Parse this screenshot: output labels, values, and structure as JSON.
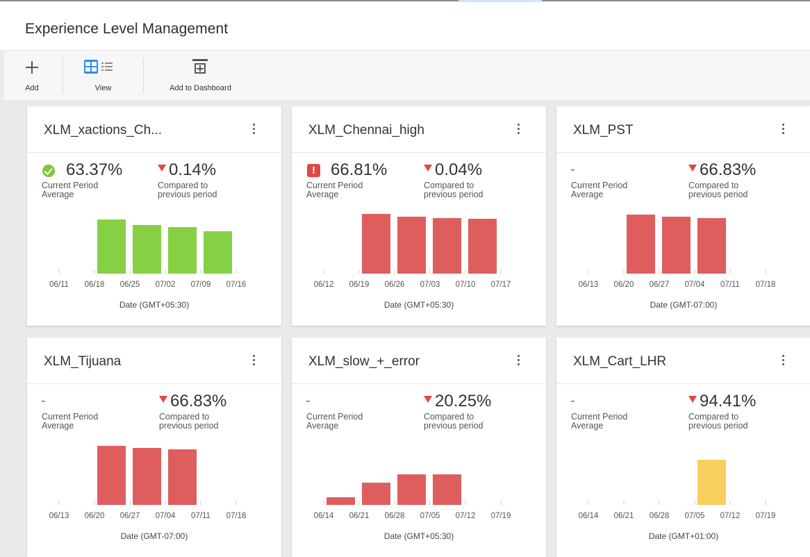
{
  "header": {
    "title": "Experience Level Management"
  },
  "toolbar": {
    "add_label": "Add",
    "view_label": "View",
    "dashboard_label": "Add to Dashboard"
  },
  "colors": {
    "good": "#86d043",
    "bad": "#de5e5e",
    "warn": "#f7cf5c",
    "accent": "#2f8ee8"
  },
  "cards": [
    {
      "name": "XLM_xactions_Ch...",
      "status_icon": "check-circle-icon",
      "current_value": "63.37%",
      "current_label": "Current Period Average",
      "compare_value": "0.14%",
      "compare_label": "Compared to previous period",
      "chart_data": {
        "type": "bar",
        "color": "#86d043",
        "categories": [
          "06/11",
          "06/18",
          "06/25",
          "07/02",
          "07/09",
          "07/16"
        ],
        "values": [
          null,
          0.65,
          0.58,
          0.56,
          0.51,
          null
        ],
        "ylim": [
          0,
          1
        ],
        "xlabel": "Date (GMT+05:30)"
      }
    },
    {
      "name": "XLM_Chennai_high",
      "status_icon": "alert-square-icon",
      "current_value": "66.81%",
      "current_label": "Current Period Average",
      "compare_value": "0.04%",
      "compare_label": "Compared to previous period",
      "chart_data": {
        "type": "bar",
        "color": "#de5e5e",
        "categories": [
          "06/12",
          "06/19",
          "06/26",
          "07/03",
          "07/10",
          "07/17"
        ],
        "values": [
          null,
          0.72,
          0.68,
          0.67,
          0.66,
          null
        ],
        "ylim": [
          0,
          1
        ],
        "xlabel": "Date (GMT+05:30)"
      }
    },
    {
      "name": "XLM_PST",
      "status_icon": "",
      "current_value": "-",
      "current_label": "Current Period Average",
      "compare_value": "66.83%",
      "compare_label": "Compared to previous period",
      "chart_data": {
        "type": "bar",
        "color": "#de5e5e",
        "categories": [
          "06/13",
          "06/20",
          "06/27",
          "07/04",
          "07/11",
          "07/18"
        ],
        "values": [
          null,
          0.71,
          0.68,
          0.67,
          null,
          null
        ],
        "ylim": [
          0,
          1
        ],
        "xlabel": "Date (GMT-07:00)"
      }
    },
    {
      "name": "XLM_Tijuana",
      "status_icon": "",
      "current_value": "-",
      "current_label": "Current Period Average",
      "compare_value": "66.83%",
      "compare_label": "Compared to previous period",
      "chart_data": {
        "type": "bar",
        "color": "#de5e5e",
        "categories": [
          "06/13",
          "06/20",
          "06/27",
          "07/04",
          "07/11",
          "07/18"
        ],
        "values": [
          null,
          0.71,
          0.68,
          0.67,
          null,
          null
        ],
        "ylim": [
          0,
          1
        ],
        "xlabel": "Date (GMT-07:00)"
      }
    },
    {
      "name": "XLM_slow_+_error",
      "status_icon": "",
      "current_value": "-",
      "current_label": "Current Period Average",
      "compare_value": "20.25%",
      "compare_label": "Compared to previous period",
      "chart_data": {
        "type": "bar",
        "color": "#de5e5e",
        "categories": [
          "06/14",
          "06/21",
          "06/28",
          "07/05",
          "07/12",
          "07/19"
        ],
        "values": [
          0.09,
          0.27,
          0.37,
          0.37,
          null,
          null
        ],
        "ylim": [
          0,
          1
        ],
        "xlabel": "Date (GMT+05:30)"
      }
    },
    {
      "name": "XLM_Cart_LHR",
      "status_icon": "",
      "current_value": "-",
      "current_label": "Current Period Average",
      "compare_value": "94.41%",
      "compare_label": "Compared to previous period",
      "chart_data": {
        "type": "bar",
        "color": "#f7cf5c",
        "categories": [
          "06/14",
          "06/21",
          "06/28",
          "07/05",
          "07/12",
          "07/19"
        ],
        "values": [
          null,
          null,
          null,
          0.54,
          null,
          null
        ],
        "ylim": [
          0,
          1
        ],
        "xlabel": "Date (GMT+01:00)"
      }
    }
  ]
}
